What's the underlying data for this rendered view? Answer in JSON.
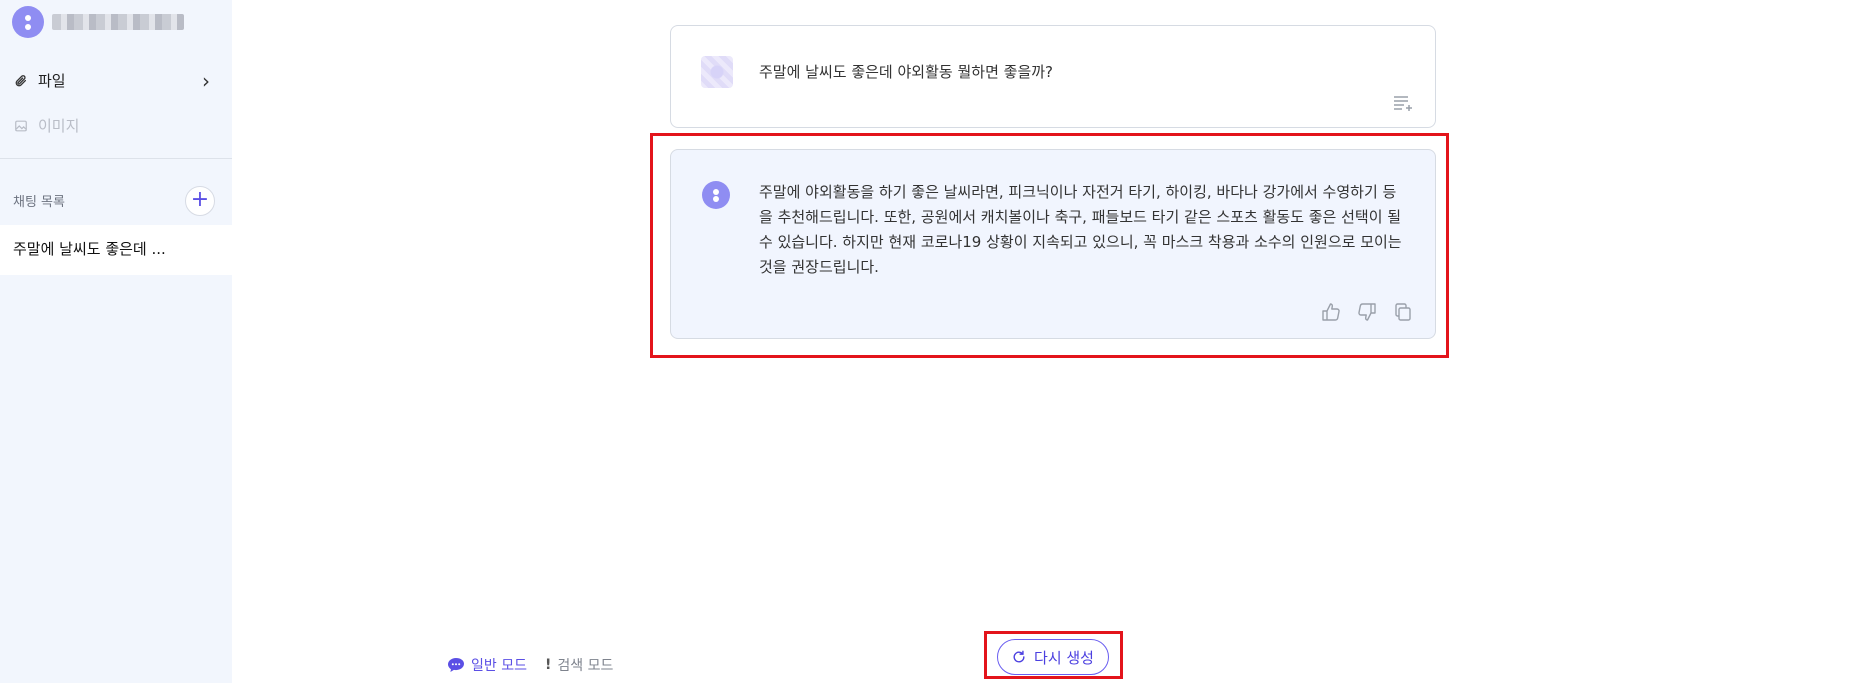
{
  "sidebar": {
    "files_label": "파일",
    "images_label": "이미지",
    "chat_list_title": "채팅 목록",
    "add_chat_symbol": "+",
    "chats": [
      {
        "title": "주말에 날씨도 좋은데 ..."
      }
    ]
  },
  "conversation": {
    "user_message": "주말에 날씨도 좋은데 야외활동 뭘하면 좋을까?",
    "bot_message": "주말에 야외활동을 하기 좋은 날씨라면, 피크닉이나 자전거 타기, 하이킹, 바다나 강가에서 수영하기 등을 추천해드립니다. 또한, 공원에서 캐치볼이나 축구, 패들보드 타기 같은 스포츠 활동도 좋은 선택이 될 수 있습니다. 하지만 현재 코로나19 상황이 지속되고 있으니, 꼭 마스크 착용과 소수의 인원으로 모이는 것을 권장드립니다."
  },
  "footer": {
    "normal_mode": "일반 모드",
    "search_mode": "검색 모드",
    "regenerate": "다시 생성"
  },
  "colors": {
    "accent": "#5b4fe5",
    "highlight": "#e3141b",
    "sidebar_bg": "#f2f6fd",
    "bot_bubble_bg": "#f1f5fe"
  }
}
